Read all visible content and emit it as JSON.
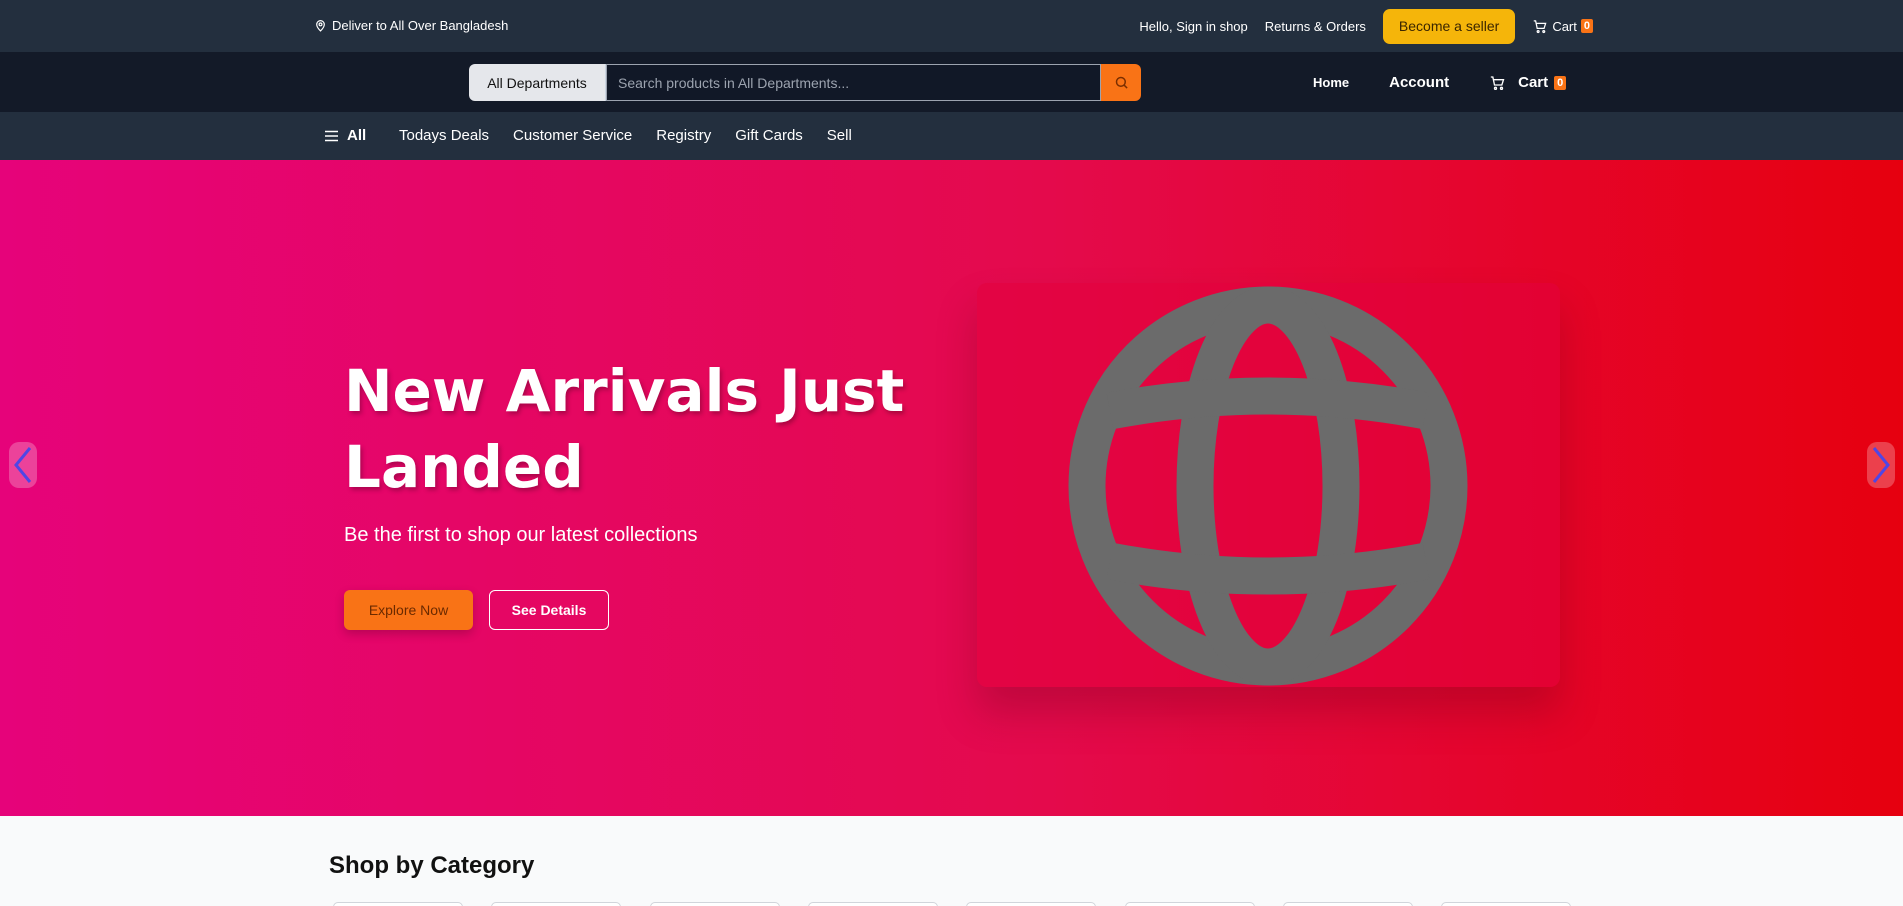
{
  "topbar": {
    "deliver_text": "Deliver to All Over Bangladesh",
    "signin": "Hello, Sign in shop",
    "returns": "Returns & Orders",
    "seller_button": "Become a seller",
    "cart_label": "Cart",
    "cart_count": "0"
  },
  "search": {
    "department": "All Departments",
    "placeholder": "Search products in All Departments..."
  },
  "mainnav": {
    "home": "Home",
    "account": "Account",
    "cart_label": "Cart",
    "cart_count": "0"
  },
  "catnav": {
    "all": "All",
    "links": [
      "Todays Deals",
      "Customer Service",
      "Registry",
      "Gift Cards",
      "Sell"
    ]
  },
  "hero": {
    "title": "New Arrivals Just Landed",
    "subtitle": "Be the first to shop our latest collections",
    "primary_button": "Explore Now",
    "secondary_button": "See Details",
    "image_icon": "globe-icon"
  },
  "categories": {
    "title": "Shop by Category"
  },
  "colors": {
    "topbar": "#232f3e",
    "searchbar": "#131a28",
    "accent_orange": "#f97316",
    "seller_yellow": "#f5b50a",
    "hero_start": "#e6037a",
    "hero_end": "#e6000f"
  }
}
